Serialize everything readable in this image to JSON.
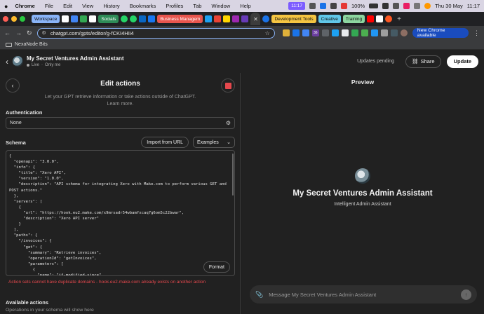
{
  "macos": {
    "apple": "",
    "menu": [
      "Chrome",
      "File",
      "Edit",
      "View",
      "History",
      "Bookmarks",
      "Profiles",
      "Tab",
      "Window",
      "Help"
    ],
    "clock_date": "Thu 30 May",
    "clock_time": "11:17",
    "battery": "100%",
    "badge": "11:17"
  },
  "tabs": {
    "workspace": "Workspace",
    "socials": "Socials",
    "business": "Business Managem",
    "dev_tools": "Development Tools",
    "creative": "Creative",
    "training": "Training"
  },
  "toolbar": {
    "url": "chatgpt.com/gpts/editor/g-fCKI4HIi4",
    "update_chrome": "New Chrome available",
    "ext_badge": "36"
  },
  "bookmarks": {
    "folder": "NexaNode Bits"
  },
  "header": {
    "gpt_name": "My Secret Ventures Admin Assistant",
    "status_live": "Live",
    "visibility": "Only me",
    "pending": "Updates pending",
    "share": "Share",
    "update": "Update"
  },
  "edit_actions": {
    "title": "Edit actions",
    "subtitle_1": "Let your GPT retrieve information or take actions outside of ChatGPT.",
    "subtitle_2": "Learn more.",
    "auth_label": "Authentication",
    "auth_value": "None",
    "schema_label": "Schema",
    "import_url": "Import from URL",
    "examples": "Examples",
    "schema_text": "{\n  \"openapi\": \"3.0.0\",\n  \"info\": {\n    \"title\": \"Xero API\",\n    \"version\": \"1.0.0\",\n    \"description\": \"API schema for integrating Xero with Make.com to perform various GET and\nPOST actions.\"\n  },\n  \"servers\": [\n    {\n      \"url\": \"https://hook.eu2.make.com/x9mrsadr54wbamfxcaq7g6om5c22bwar\",\n      \"description\": \"Xero API server\"\n    }\n  ],\n  \"paths\": {\n    \"/invoices\": {\n      \"get\": {\n        \"summary\": \"Retrieve invoices\",\n        \"operationId\": \"getInvoices\",\n        \"parameters\": [\n          {\n            \"name\": \"if-modified-since\",\n            \"in\": \"query\",\n            \"required\": false,",
    "format": "Format",
    "error": "Action sets cannot have duplicate domains - hook.eu2.make.com already exists on another action",
    "available_label": "Available actions",
    "available_sub": "Operations in your schema will show here"
  },
  "preview": {
    "title": "Preview",
    "name": "My Secret Ventures Admin Assistant",
    "description": "Intelligent Admin Assistant",
    "placeholder": "Message My Secret Ventures Admin Assistant"
  },
  "colors": {
    "accent_blue": "#8ab4f8",
    "error_red": "#e5484d",
    "workspace_tab": "#8ab4f8",
    "socials_tab": "#2e8b57",
    "business_tab": "#e8554e",
    "dev_tab": "#f5c542",
    "creative_tab": "#61c7e8",
    "training_tab": "#8dd6a0"
  }
}
